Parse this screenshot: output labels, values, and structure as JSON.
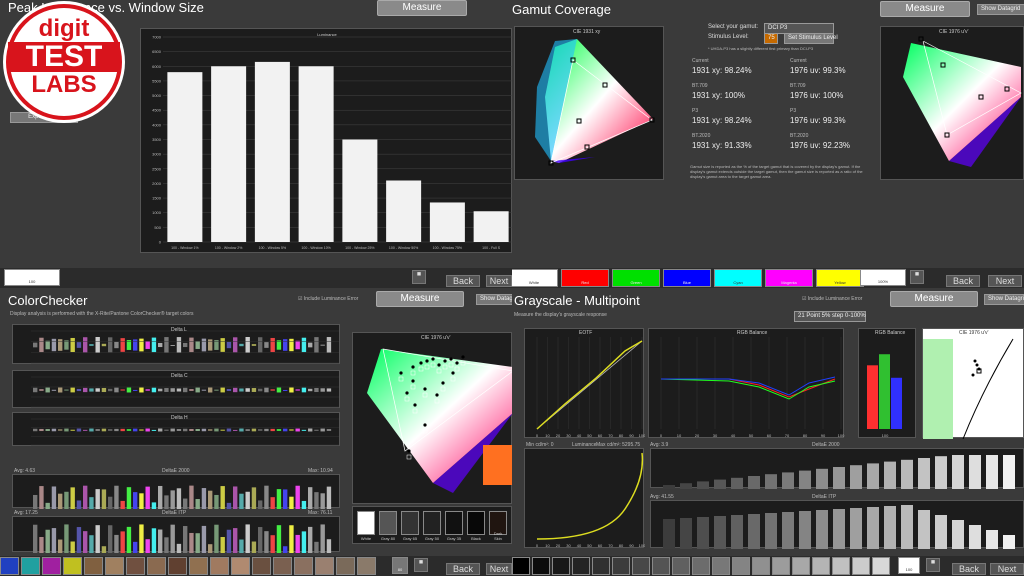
{
  "logo": {
    "line1": "digit",
    "line2": "TEST",
    "line3": "LABS"
  },
  "q1": {
    "title": "Peak Luminance vs. Window Size",
    "measure": "Measure",
    "export": "Export Data",
    "chart_label": "Luminance",
    "bottom_label": "100"
  },
  "chart_data": [
    {
      "type": "bar",
      "title": "Luminance",
      "categories": [
        "100 - Window 1%",
        "100 - Window 2%",
        "100 - Window 5%",
        "100 - Window 10%",
        "100 - Window 25%",
        "100 - Window 50%",
        "100 - Window 75%",
        "100 - Full S"
      ],
      "values": [
        5800,
        6000,
        6150,
        6000,
        3500,
        2100,
        1350,
        1050
      ],
      "ylim": [
        0,
        7000
      ],
      "yticks": [
        0,
        500,
        1000,
        1500,
        2000,
        2500,
        3000,
        3500,
        4000,
        4500,
        5000,
        5500,
        6000,
        6500,
        7000
      ]
    },
    {
      "type": "line",
      "title": "EOTF",
      "x": [
        0,
        10,
        20,
        30,
        40,
        50,
        60,
        70,
        80,
        90,
        100
      ]
    },
    {
      "type": "bar",
      "title": "RGB Balance",
      "categories": [
        "R",
        "G",
        "B"
      ],
      "values": [
        92,
        108,
        74
      ],
      "ylim": [
        0,
        130
      ]
    }
  ],
  "q2": {
    "title": "Gamut Coverage",
    "measure": "Measure",
    "show_datagrid": "Show Datagrid",
    "select_label": "Select your gamut:",
    "select_value": "DCI P3",
    "stimulus_label": "Stimulus Level:",
    "stimulus_value": "75",
    "set_stimulus": "Set Stimulus Level",
    "note": "* UHDA-P3 has a slightly different first primary than DCI-P3",
    "left_chart": "CIE 1931 xy",
    "right_chart": "CIE 1976 u'v'",
    "rows": [
      {
        "l1": "Current",
        "v1": "1931 xy: 98.24%",
        "l2": "Current",
        "v2": "1976 uv: 99.3%"
      },
      {
        "l1": "BT.709",
        "v1": "1931 xy: 100%",
        "l2": "BT.709",
        "v2": "1976 uv: 100%"
      },
      {
        "l1": "P3",
        "v1": "1931 xy: 98.24%",
        "l2": "P3",
        "v2": "1976 uv: 99.3%"
      },
      {
        "l1": "BT.2020",
        "v1": "1931 xy: 91.33%",
        "l2": "BT.2020",
        "v2": "1976 uv: 92.23%"
      }
    ],
    "footnote": "Gamut size is reported as the % of the target gamut that is covered by the display's gamut. If the display's gamut extends outside the target gamut, then the gamut size is reported as a ratio of the display's gamut area to the target gamut area.",
    "swatches": [
      {
        "label": "White",
        "color": "#ffffff"
      },
      {
        "label": "Red",
        "color": "#ff0000"
      },
      {
        "label": "Green",
        "color": "#00e000"
      },
      {
        "label": "Blue",
        "color": "#0000ff"
      },
      {
        "label": "Cyan",
        "color": "#00ffff"
      },
      {
        "label": "Magenta",
        "color": "#ff00ff"
      },
      {
        "label": "Yellow",
        "color": "#ffff00"
      }
    ],
    "bottom_label": "100%"
  },
  "q3": {
    "title": "ColorChecker",
    "measure": "Measure",
    "include_lum": "Include Luminance Error",
    "show_datagrid": "Show Datagrid",
    "desc": "Display analysis is performed with the X-Rite/Pantone ColorChecker® target colors",
    "delta_l": "Delta L",
    "delta_c": "Delta C",
    "delta_h": "Delta H",
    "avg1": "Avg: 4.63",
    "de2000": "DeltaE 2000",
    "max1": "Max: 10.94",
    "avg2": "Avg: 17.25",
    "deitp": "DeltaE ITP",
    "max2": "Max: 76.11",
    "cie": "CIE 1976 u'v'",
    "grays": [
      "White",
      "Gray 80",
      "Gray 65",
      "Gray 50",
      "Gray 35",
      "Black",
      "Dark Skin"
    ],
    "bottom_label": "80"
  },
  "q4": {
    "title": "Grayscale - Multipoint",
    "measure": "Measure",
    "include_lum": "Include Luminance Error",
    "show_datagrid": "Show Datagrid",
    "desc": "Measure the display's grayscale response",
    "select_value": "21 Point 5% step 0-100%",
    "eotf": "EOTF",
    "rgb_balance": "RGB Balance",
    "rgb_balance2": "RGB Balance",
    "cie": "CIE 1976 u'v'",
    "min_lum": "Min cd/m²: 0",
    "luminance": "Luminance",
    "max_lum": "Max cd/m²: 5295.75",
    "avg1": "Avg: 3.9",
    "de2000": "DeltaE 2000",
    "avg2": "Avg: 41.55",
    "deitp": "DeltaE ITP",
    "bar_label": "100",
    "bottom_label": "100"
  },
  "nav": {
    "back": "Back",
    "next": "Next"
  }
}
